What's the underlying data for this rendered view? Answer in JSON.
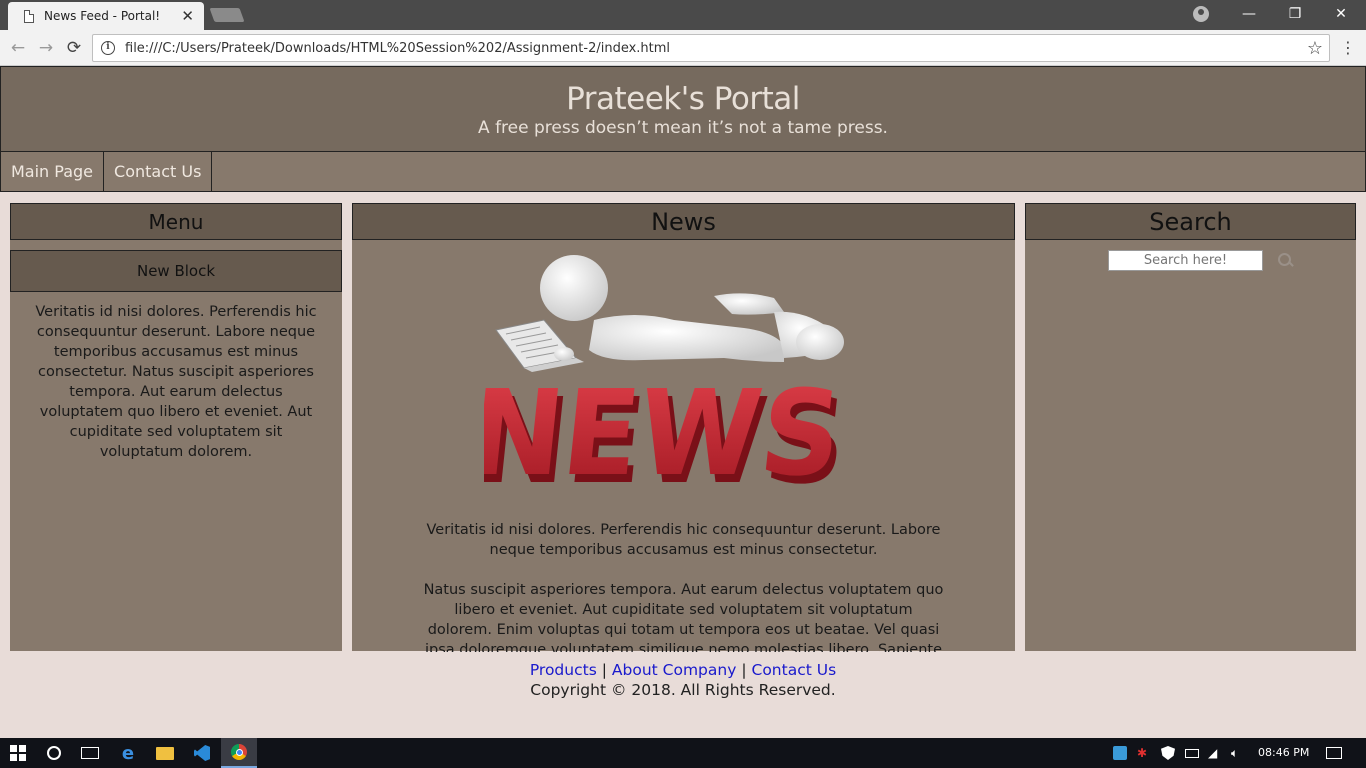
{
  "browser": {
    "tab_title": "News Feed - Portal!",
    "tab_close": "✕",
    "url": "file:///C:/Users/Prateek/Downloads/HTML%20Session%202/Assignment-2/index.html",
    "back": "←",
    "forward": "→",
    "reload": "⟳",
    "star": "☆",
    "menu": "⋮",
    "minimize": "—",
    "restore": "❐",
    "close": "✕"
  },
  "header": {
    "title": "Prateek's Portal",
    "tagline": "A free press doesn’t mean it’s not a tame press."
  },
  "nav": {
    "items": [
      "Main Page",
      "Contact Us"
    ]
  },
  "left": {
    "heading": "Menu",
    "subheading": "New Block",
    "text": "Veritatis id nisi dolores. Perferendis hic consequuntur deserunt. Labore neque temporibus accusamus est minus consectetur. Natus suscipit asperiores tempora. Aut earum delectus voluptatem quo libero et eveniet. Aut cupiditate sed voluptatem sit voluptatum dolorem."
  },
  "middle": {
    "heading": "News",
    "image_text": "NEWS",
    "paragraph1": "Veritatis id nisi dolores. Perferendis hic consequuntur deserunt. Labore neque temporibus accusamus est minus consectetur.",
    "paragraph2": "Natus suscipit asperiores tempora. Aut earum delectus voluptatem quo libero et eveniet. Aut cupiditate sed voluptatem sit voluptatum dolorem. Enim voluptas qui totam ut tempora eos ut beatae. Vel quasi ipsa doloremque voluptatem similique nemo molestias libero. Sapiente ipsum"
  },
  "right": {
    "heading": "Search",
    "search_placeholder": "Search here!"
  },
  "footer": {
    "links": [
      "Products",
      "About Company",
      "Contact Us"
    ],
    "separator": "|",
    "copyright": "Copyright © 2018. All Rights Reserved."
  },
  "taskbar": {
    "time": "08:46 PM"
  },
  "colors": {
    "header_bg": "#766a5e",
    "panel_bg": "#87796c",
    "panel_head_bg": "#665a4e",
    "page_bg": "#e8dcd8",
    "link": "#1a1acc"
  }
}
